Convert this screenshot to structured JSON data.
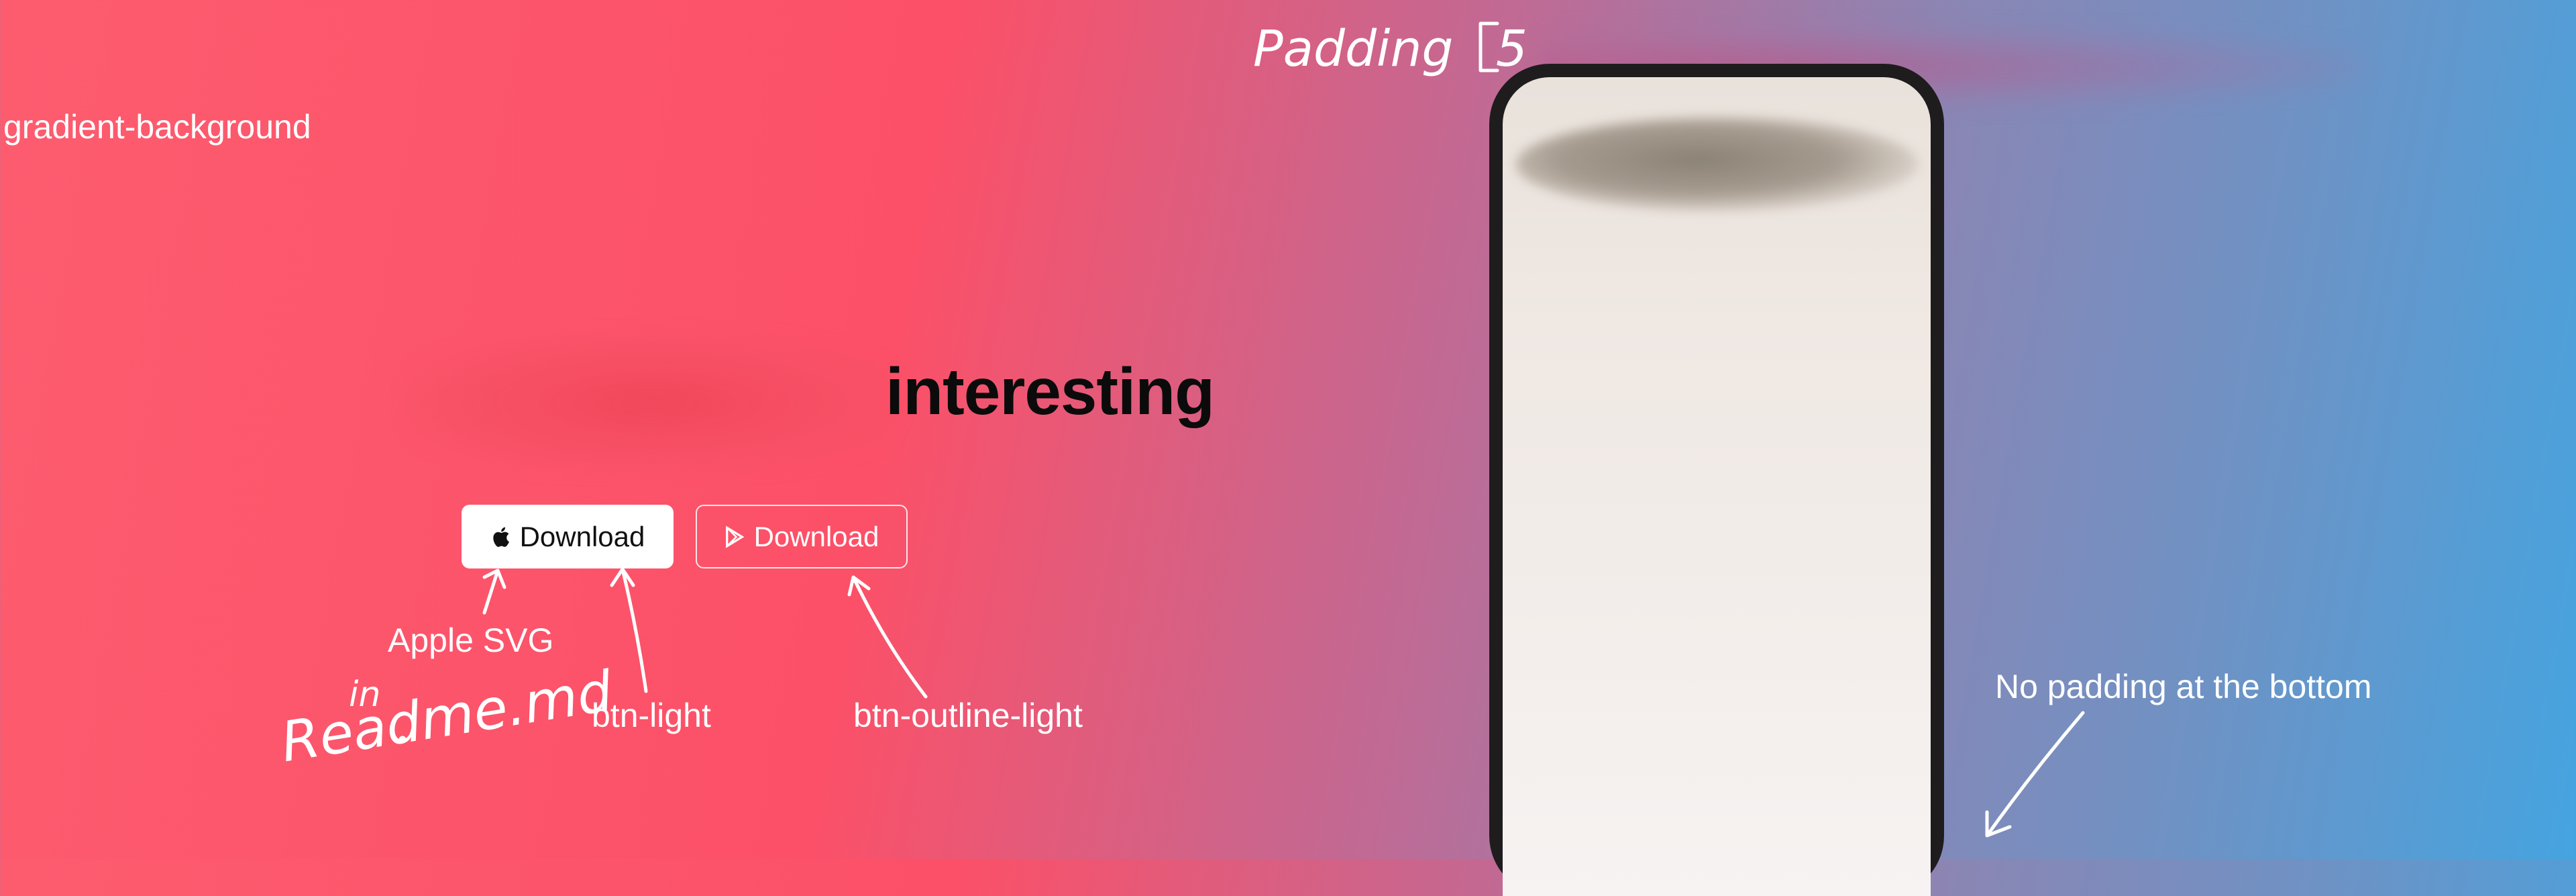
{
  "annotations": {
    "gradient_background": "gradient-background",
    "padding_label": "Padding",
    "padding_value": "5",
    "apple_svg": "Apple SVG",
    "in_label": "in",
    "readme": "Readme.md",
    "btn_light": "btn-light",
    "btn_outline_light": "btn-outline-light",
    "no_padding_bottom": "No padding at the bottom"
  },
  "hero": {
    "headline": "interesting"
  },
  "buttons": {
    "apple_download": "Download",
    "play_download": "Download"
  },
  "icons": {
    "apple": "apple-icon",
    "play": "play-store-icon"
  },
  "colors": {
    "gradient_start": "#fd5c6f",
    "gradient_end": "#45a4e0",
    "headline": "#0b0b0b"
  }
}
